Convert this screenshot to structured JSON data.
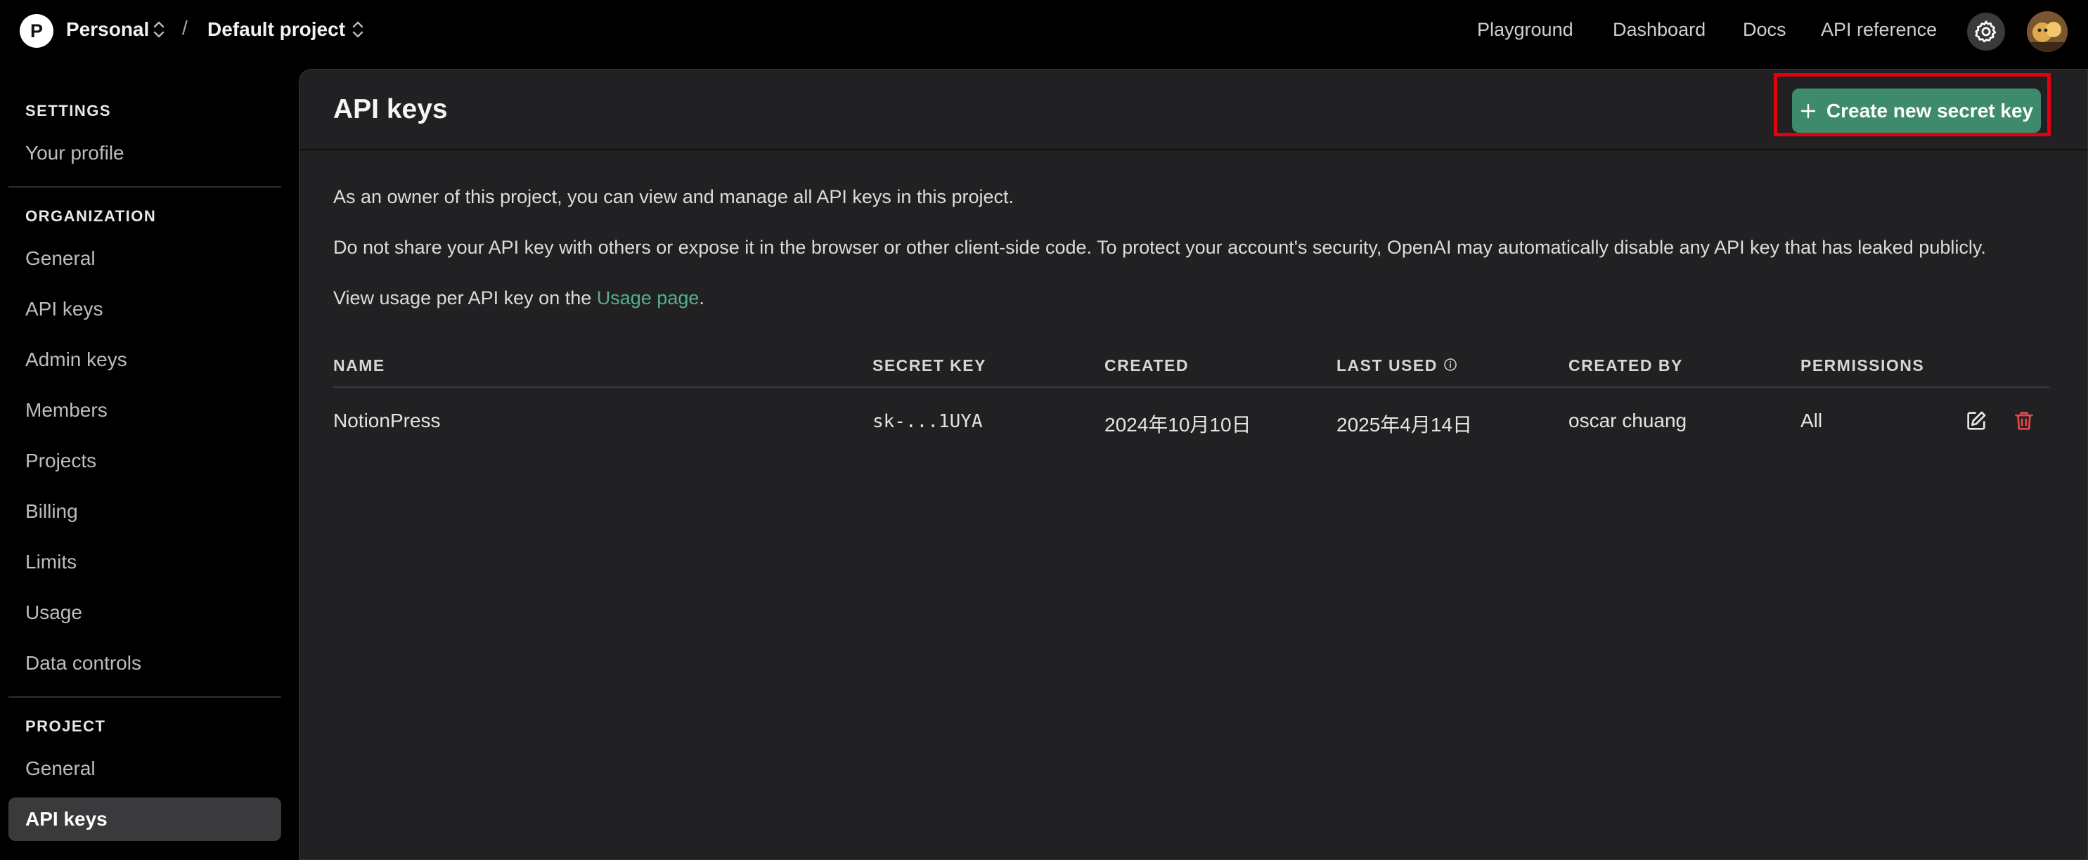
{
  "header": {
    "org_initial": "P",
    "org_name": "Personal",
    "separator": "/",
    "project_name": "Default project",
    "nav": {
      "playground": "Playground",
      "dashboard": "Dashboard",
      "docs": "Docs",
      "api_reference": "API reference"
    },
    "icons": [
      "chevron-updown-icon",
      "gear-icon",
      "user-avatar"
    ]
  },
  "sidebar": {
    "settings_heading": "SETTINGS",
    "settings_items": [
      {
        "label": "Your profile"
      }
    ],
    "organization_heading": "ORGANIZATION",
    "organization_items": [
      {
        "label": "General"
      },
      {
        "label": "API keys"
      },
      {
        "label": "Admin keys"
      },
      {
        "label": "Members"
      },
      {
        "label": "Projects"
      },
      {
        "label": "Billing"
      },
      {
        "label": "Limits"
      },
      {
        "label": "Usage"
      },
      {
        "label": "Data controls"
      }
    ],
    "project_heading": "PROJECT",
    "project_items": [
      {
        "label": "General"
      },
      {
        "label": "API keys",
        "active": true
      }
    ]
  },
  "main": {
    "title": "API keys",
    "create_button_label": "Create new secret key",
    "paragraph_owner": "As an owner of this project, you can view and manage all API keys in this project.",
    "paragraph_warning": "Do not share your API key with others or expose it in the browser or other client-side code. To protect your account's security, OpenAI may automatically disable any API key that has leaked publicly.",
    "usage_prefix": "View usage per API key on the ",
    "usage_link": "Usage page",
    "usage_suffix": ".",
    "table": {
      "columns": [
        "NAME",
        "SECRET KEY",
        "CREATED",
        "LAST USED",
        "CREATED BY",
        "PERMISSIONS"
      ],
      "rows": [
        {
          "name": "NotionPress",
          "secret_key": "sk-...1UYA",
          "created": "2024年10月10日",
          "last_used": "2025年4月14日",
          "created_by": "oscar chuang",
          "permissions": "All"
        }
      ]
    }
  },
  "colors": {
    "accent_button": "#3e8a6d",
    "link": "#56b08a",
    "delete": "#e5484d",
    "highlight": "#e3000f"
  }
}
